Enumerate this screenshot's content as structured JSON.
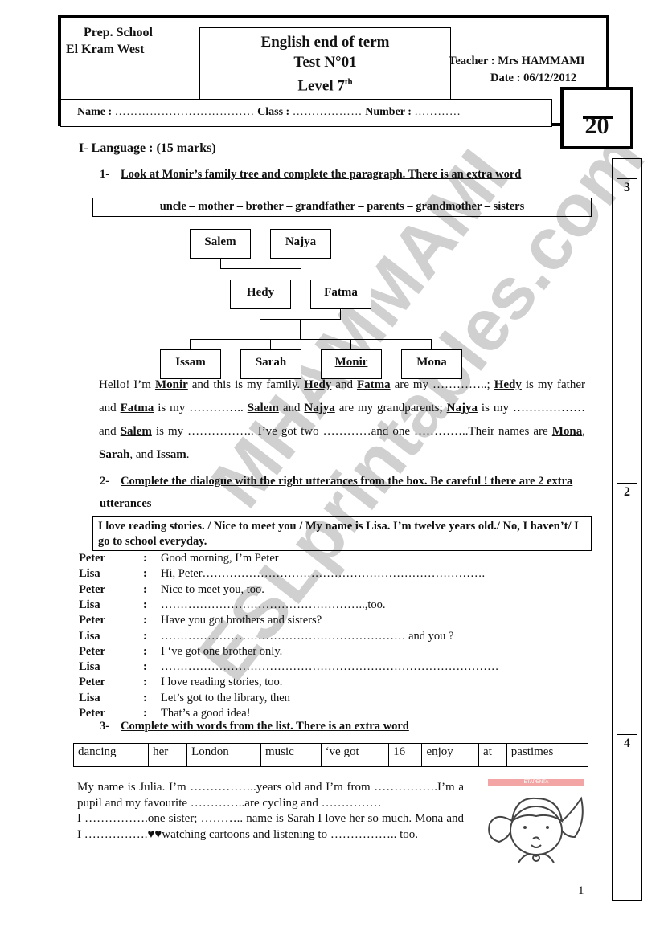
{
  "header": {
    "school_line1": "Prep. School",
    "school_line2": "El Kram West",
    "title_line1": "English end of term",
    "title_line2": "Test N°01",
    "title_line3": "Level 7",
    "title_level_sup": "th",
    "teacher": "Teacher : Mrs HAMMAMI",
    "date": "Date : 06/12/2012",
    "name_label": "Name :",
    "name_dots": "………………………………",
    "class_label": "Class :",
    "class_dots": "………………",
    "number_label": "Number :",
    "number_dots": "…………",
    "total_score": "20"
  },
  "section1": {
    "heading": "I- Language : (15 marks)",
    "ex1": {
      "number": "1-",
      "instruction": "Look at Monir’s family tree and complete the paragraph. There is an extra word",
      "word_box": "uncle – mother – brother – grandfather – parents – grandmother – sisters",
      "marks": "3",
      "tree": {
        "grandparents": [
          "Salem",
          "Najya"
        ],
        "parents": [
          "Hedy",
          "Fatma"
        ],
        "children": [
          "Issam",
          "Sarah",
          "Monir",
          "Mona"
        ]
      },
      "paragraph": [
        [
          "t",
          "Hello! I’m "
        ],
        [
          "n",
          "Monir"
        ],
        [
          "t",
          " and this is my family. "
        ],
        [
          "n",
          "Hedy"
        ],
        [
          "t",
          " and "
        ],
        [
          "n",
          "Fatma"
        ],
        [
          "t",
          " are my …………..; "
        ],
        [
          "n",
          "Hedy"
        ],
        [
          "t",
          " is my father and "
        ],
        [
          "n",
          "Fatma"
        ],
        [
          "t",
          " is my ………….. "
        ],
        [
          "n",
          "Salem"
        ],
        [
          "t",
          " and "
        ],
        [
          "n",
          "Najya"
        ],
        [
          "t",
          " are my grandparents; "
        ],
        [
          "n",
          "Najya"
        ],
        [
          "t",
          " is my ………………and "
        ],
        [
          "n",
          "Salem"
        ],
        [
          "t",
          " is my …………….. I’ve got two …………and one …………..Their names are "
        ],
        [
          "n",
          "Mona"
        ],
        [
          "t",
          ", "
        ],
        [
          "n",
          "Sarah"
        ],
        [
          "t",
          ", and "
        ],
        [
          "n",
          "Issam"
        ],
        [
          "t",
          "."
        ]
      ]
    },
    "ex2": {
      "number": "2-",
      "instruction": "Complete the dialogue with the right utterances from the box. Be careful ! there are 2 extra utterances",
      "box": "I love reading stories. / Nice to meet you / My name is Lisa. I’m twelve years old./ No, I haven’t/ I go to school everyday.",
      "marks": "2",
      "dialogue": [
        {
          "speaker": "Peter",
          "line": "Good morning, I’m Peter"
        },
        {
          "speaker": "Lisa",
          "line": "Hi, Peter………………………………………………………………."
        },
        {
          "speaker": "Peter",
          "line": "Nice to meet you, too."
        },
        {
          "speaker": "Lisa",
          "line": "……………………………………………..,too."
        },
        {
          "speaker": "Peter",
          "line": "Have you got brothers and sisters?"
        },
        {
          "speaker": "Lisa",
          "line": "……………………………………………………… and you ?"
        },
        {
          "speaker": "Peter",
          "line": "I ‘ve got one brother only."
        },
        {
          "speaker": "Lisa",
          "line": "……………………………………………………………………………"
        },
        {
          "speaker": "Peter",
          "line": "I love reading stories, too."
        },
        {
          "speaker": "Lisa",
          "line": "Let’s got to the library, then"
        },
        {
          "speaker": "Peter",
          "line": "That’s a good idea!"
        }
      ],
      "separator": ":"
    },
    "ex3": {
      "number": "3-",
      "instruction": "Complete with words from the list. There is an extra word",
      "words": [
        "dancing",
        "her",
        "London",
        "music",
        "‘ve got",
        "16",
        "enjoy",
        "at",
        "pastimes"
      ],
      "marks": "4",
      "paragraph_lines": [
        "My name is Julia. I’m ……………..years old and I’m from …………….I’m a pupil and my favourite …………..are cycling and ……………",
        "I …………….one sister; ……….. name is Sarah I love her so much. Mona and I …………….♥♥watching cartoons and listening to …………….. too."
      ],
      "image_caption": "ETAPENTA"
    }
  },
  "page_number": "1",
  "watermark": [
    "ESLprintables.com",
    "MHAMMAMI"
  ]
}
